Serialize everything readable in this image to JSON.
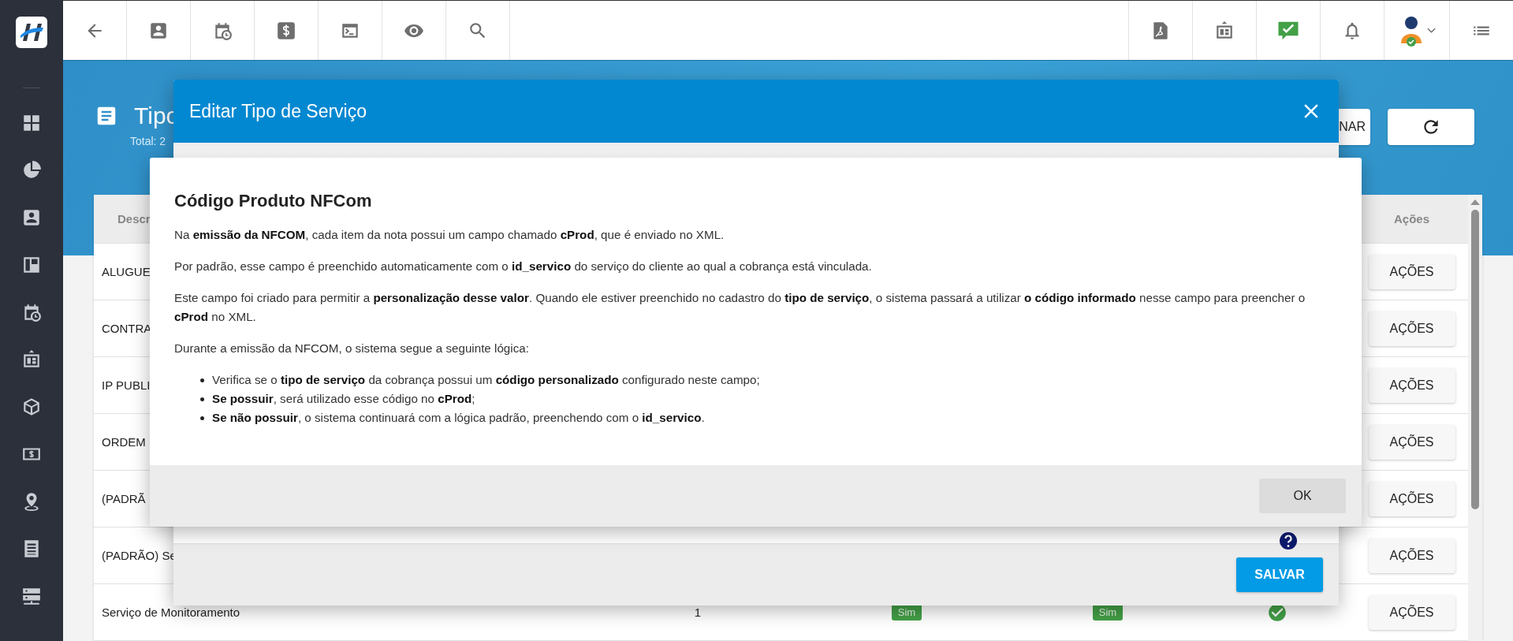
{
  "page": {
    "title": "Tipo",
    "total": "Total: 2",
    "header_button": "NAR"
  },
  "table": {
    "columns": [
      "Descr",
      "Ações"
    ],
    "rows": [
      {
        "description": "ALUGUE",
        "action": "AÇÕES"
      },
      {
        "description": "CONTRA",
        "action": "AÇÕES"
      },
      {
        "description": "IP PUBLI",
        "action": "AÇÕES"
      },
      {
        "description": "ORDEM",
        "action": "AÇÕES"
      },
      {
        "description": "(PADRÃ",
        "action": "AÇÕES"
      },
      {
        "description": "(PADRÃO) Se",
        "action": "AÇÕES"
      },
      {
        "description": "Serviço de Monitoramento",
        "column_2": "1",
        "column_3": "Sim",
        "column_4": "Sim",
        "checked": true,
        "action": "AÇÕES"
      }
    ]
  },
  "edit_dialog": {
    "title": "Editar Tipo de Serviço",
    "save_button": "SALVAR"
  },
  "help_dialog": {
    "title": "Código Produto NFCom",
    "paragraphs": [
      "Na **emissão da NFCOM**, cada item da nota possui um campo chamado **cProd**, que é enviado no XML.",
      "Por padrão, esse campo é preenchido automaticamente com o **id_servico** do serviço do cliente ao qual a cobrança está vinculada.",
      "Este campo foi criado para permitir a **personalização desse valor**. Quando ele estiver preenchido no cadastro do **tipo de serviço**, o sistema passará a utilizar **o código informado** nesse campo para preencher o **cProd** no XML.",
      "Durante a emissão da NFCOM, o sistema segue a seguinte lógica:"
    ],
    "bullets": [
      "Verifica se o **tipo de serviço** da cobrança possui um **código personalizado** configurado neste campo;",
      "**Se possuir**, será utilizado esse código no **cProd**;",
      "**Se não possuir**, o sistema continuará com a lógica padrão, preenchendo com o **id_servico**."
    ],
    "ok_button": "OK"
  }
}
